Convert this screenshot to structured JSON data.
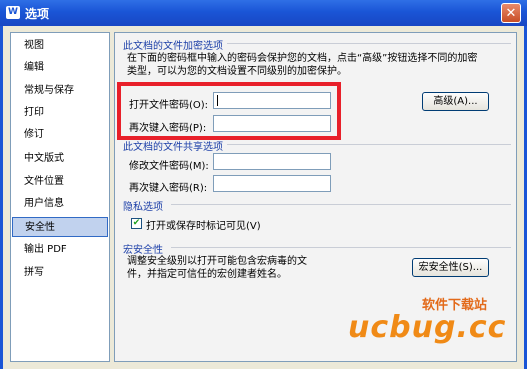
{
  "window": {
    "title": "选项",
    "icon": "W",
    "close_label": "✕"
  },
  "sidebar": {
    "items": [
      {
        "label": "视图"
      },
      {
        "label": "编辑"
      },
      {
        "label": "常规与保存"
      },
      {
        "label": "打印"
      },
      {
        "label": "修订"
      },
      {
        "label": "中文版式"
      },
      {
        "label": "文件位置"
      },
      {
        "label": "用户信息"
      },
      {
        "label": "安全性"
      },
      {
        "label": "输出 PDF"
      },
      {
        "label": "拼写"
      }
    ],
    "active_index": 8
  },
  "encrypt": {
    "title": "此文档的文件加密选项",
    "desc_line1": "在下面的密码框中输入的密码会保护您的文档，点击“高级”按钮选择不同的加密",
    "desc_line2": "类型，可以为您的文档设置不同级别的加密保护。",
    "open_pwd_label": "打开文件密码(O):",
    "reenter_label": "再次键入密码(P):",
    "advanced_button": "高级(A)..."
  },
  "share": {
    "title": "此文档的文件共享选项",
    "modify_pwd_label": "修改文件密码(M):",
    "reenter_label": "再次键入密码(R):"
  },
  "privacy": {
    "title": "隐私选项",
    "checkbox_label": "打开或保存时标记可见(V)",
    "checked": true
  },
  "macro": {
    "title": "宏安全性",
    "desc_line1": "调整安全级别以打开可能包含宏病毒的文",
    "desc_line2": "件，并指定可信任的宏创建者姓名。",
    "button": "宏安全性(S)..."
  },
  "watermark": {
    "cn": "软件下载站",
    "en": "ucbug.cc"
  },
  "colors": {
    "highlight": "#e8202a",
    "titlebar": "#1a55d6",
    "group_title": "#1c3fa8"
  }
}
